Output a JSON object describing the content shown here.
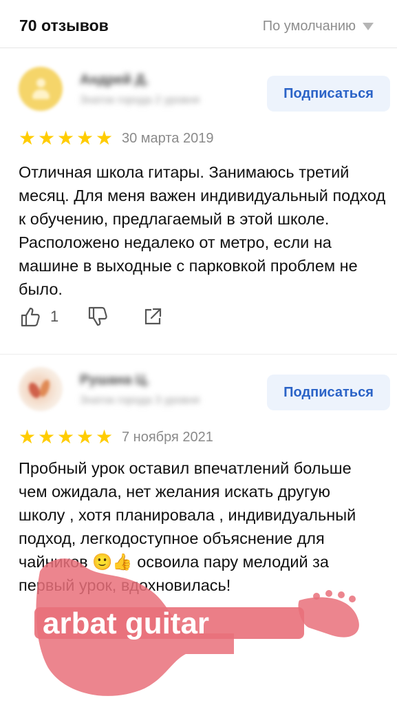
{
  "header": {
    "reviews_count": "70 отзывов",
    "sort_label": "По умолчанию"
  },
  "reviews": [
    {
      "author_blurred": "Андрей Д.",
      "author_sub_blurred": "Знаток города 2 уровня",
      "subscribe_label": "Подписаться",
      "rating": 5,
      "date": "30 марта 2019",
      "text": "Отличная школа гитары. Занимаюсь третий месяц. Для меня важен индивидуальный подход к обучению, предлагаемый в этой школе. Расположено недалеко от метро, если на машине в выходные с парковкой проблем не было.",
      "likes": "1"
    },
    {
      "author_blurred": "Рушана Ц.",
      "author_sub_blurred": "Знаток города 3 уровня",
      "subscribe_label": "Подписаться",
      "rating": 5,
      "date": "7 ноября 2021",
      "text": "Пробный урок оставил впечатлений больше чем ожидала, нет желания искать другую школу , хотя планировала , индивидуальный подход, легкодоступное объяснение для чайников 🙂👍 освоила пару мелодий за первый урок, вдохновилась!"
    }
  ],
  "watermark": {
    "text": "arbat guitar"
  },
  "colors": {
    "star": "#ffcc00",
    "subscribe_bg": "#edf3fc",
    "subscribe_text": "#2b63c7",
    "watermark": "#e9707a"
  }
}
